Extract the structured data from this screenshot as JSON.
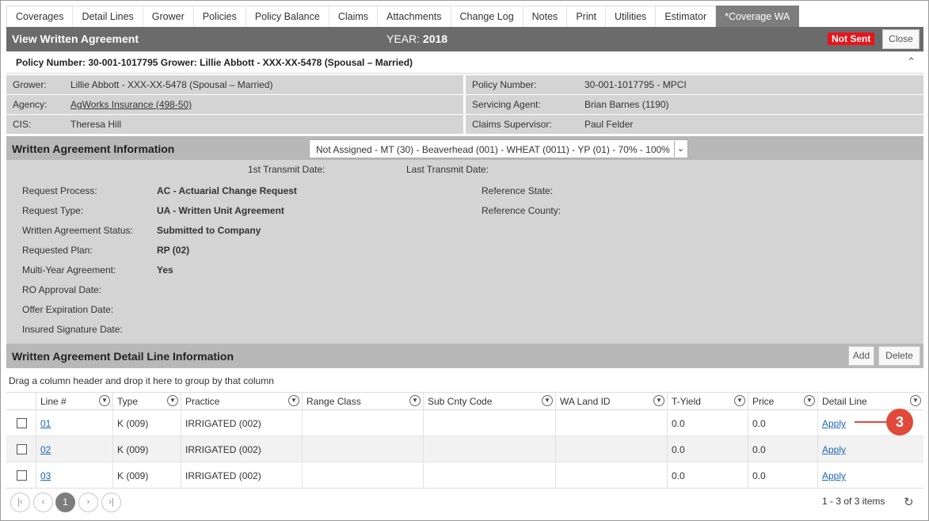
{
  "tabs": [
    {
      "label": "Coverages"
    },
    {
      "label": "Detail Lines"
    },
    {
      "label": "Grower"
    },
    {
      "label": "Policies"
    },
    {
      "label": "Policy Balance"
    },
    {
      "label": "Claims"
    },
    {
      "label": "Attachments"
    },
    {
      "label": "Change Log"
    },
    {
      "label": "Notes"
    },
    {
      "label": "Print"
    },
    {
      "label": "Utilities"
    },
    {
      "label": "Estimator"
    },
    {
      "label": "*Coverage WA"
    }
  ],
  "header": {
    "title": "View Written Agreement",
    "year_label": "YEAR:",
    "year_value": "2018",
    "status_badge": "Not Sent",
    "close_label": "Close"
  },
  "policy_line": "Policy Number: 30-001-1017795 Grower: Lillie Abbott - XXX-XX-5478 (Spousal – Married)",
  "info": {
    "grower_label": "Grower:",
    "grower_value": "Lillie Abbott - XXX-XX-5478 (Spousal – Married)",
    "agency_label": "Agency:",
    "agency_value": "AgWorks Insurance (498-50)",
    "cis_label": "CIS:",
    "cis_value": "Theresa Hill",
    "policy_number_label": "Policy Number:",
    "policy_number_value": "30-001-1017795 - MPCI",
    "servicing_agent_label": "Servicing Agent:",
    "servicing_agent_value": "Brian Barnes (1190)",
    "claims_supervisor_label": "Claims Supervisor:",
    "claims_supervisor_value": "Paul Felder"
  },
  "wa": {
    "heading": "Written Agreement Information",
    "select_value": "Not Assigned - MT (30) - Beaverhead (001) - WHEAT (0011) - YP (01) - 70% - 100%",
    "first_transmit_label": "1st Transmit Date:",
    "last_transmit_label": "Last Transmit Date:",
    "fields": [
      {
        "label": "Request Process:",
        "value": "AC - Actuarial Change Request"
      },
      {
        "label": "Request Type:",
        "value": "UA - Written Unit Agreement"
      },
      {
        "label": "Written Agreement Status:",
        "value": "Submitted to Company"
      },
      {
        "label": "Requested Plan:",
        "value": "RP (02)"
      },
      {
        "label": "Multi-Year Agreement:",
        "value": "Yes"
      },
      {
        "label": "RO Approval Date:",
        "value": ""
      },
      {
        "label": "Offer Expiration Date:",
        "value": ""
      },
      {
        "label": "Insured Signature Date:",
        "value": ""
      }
    ],
    "reference_state_label": "Reference State:",
    "reference_county_label": "Reference County:"
  },
  "detail": {
    "heading": "Written Agreement Detail Line Information",
    "add_label": "Add",
    "delete_label": "Delete",
    "group_hint": "Drag a column header and drop it here to group by that column",
    "columns": [
      "Line #",
      "Type",
      "Practice",
      "Range Class",
      "Sub Cnty Code",
      "WA Land ID",
      "T-Yield",
      "Price",
      "Detail Line"
    ],
    "rows": [
      {
        "line": "01",
        "type": "K (009)",
        "practice": "IRRIGATED (002)",
        "range_class": "",
        "sub_cnty": "",
        "land_id": "",
        "t_yield": "0.0",
        "price": "0.0",
        "detail": "Apply"
      },
      {
        "line": "02",
        "type": "K (009)",
        "practice": "IRRIGATED (002)",
        "range_class": "",
        "sub_cnty": "",
        "land_id": "",
        "t_yield": "0.0",
        "price": "0.0",
        "detail": "Apply"
      },
      {
        "line": "03",
        "type": "K (009)",
        "practice": "IRRIGATED (002)",
        "range_class": "",
        "sub_cnty": "",
        "land_id": "",
        "t_yield": "0.0",
        "price": "0.0",
        "detail": "Apply"
      }
    ],
    "callout_number": "3"
  },
  "pager": {
    "current_page": "1",
    "items_text": "1 - 3 of 3 items"
  }
}
